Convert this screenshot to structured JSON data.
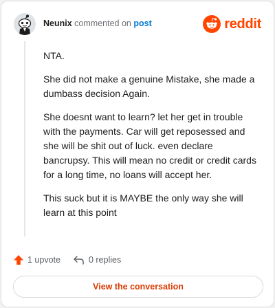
{
  "header": {
    "username": "Neunix",
    "action_text": "commented on",
    "post_link": "post",
    "brand_word": "reddit"
  },
  "comment": {
    "paragraphs": [
      "NTA.",
      "She did not make a genuine Mistake, she made a dumbass decision Again.",
      "She doesnt want to learn? let her get in trouble with the payments. Car will get reposessed and she will be shit out of luck. even declare bancrupsy. This will mean no credit or credit cards for a long time, no loans will accept her.",
      "This suck but it is MAYBE the only way she will learn at this point"
    ]
  },
  "actions": {
    "upvotes_label": "1 upvote",
    "replies_label": "0 replies"
  },
  "cta": {
    "label": "View the conversation"
  },
  "colors": {
    "brand": "#ff4500",
    "link": "#0079d3",
    "cta_text": "#d93a00"
  },
  "icons": [
    "avatar",
    "reddit-logo-icon",
    "upvote-arrow-icon",
    "reply-icon"
  ]
}
